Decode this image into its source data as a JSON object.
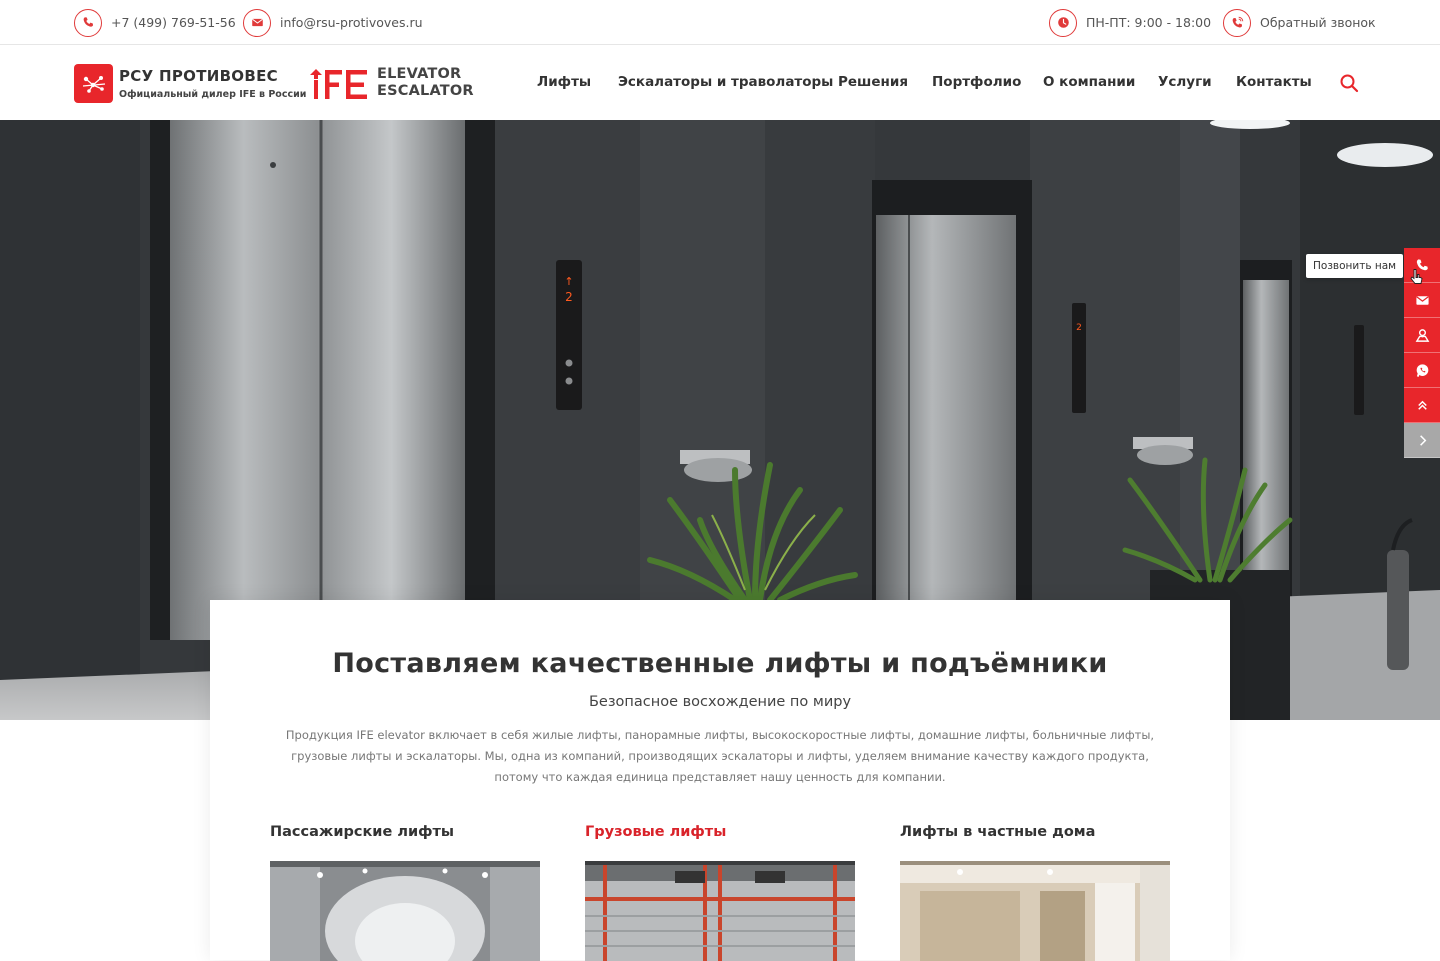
{
  "topbar": {
    "phone": "+7 (499) 769-51-56",
    "email": "info@rsu-protivoves.ru",
    "hours": "ПН-ПТ: 9:00 - 18:00",
    "callback": "Обратный звонок"
  },
  "header": {
    "brand_title": "РСУ ПРОТИВОВЕС",
    "brand_subtitle": "Официальный дилер IFE в России",
    "partner_line1": "ELEVATOR",
    "partner_line2": "ESCALATOR",
    "nav": [
      {
        "label": "Лифты"
      },
      {
        "label": "Эскалаторы и траволаторы"
      },
      {
        "label": "Решения"
      },
      {
        "label": "Портфолио"
      },
      {
        "label": "О компании"
      },
      {
        "label": "Услуги"
      },
      {
        "label": "Контакты"
      }
    ]
  },
  "floor_indicators": [
    "2",
    "2"
  ],
  "side_bar": {
    "tooltip": "Позвонить нам",
    "buttons": [
      "phone-icon",
      "mail-icon",
      "map-icon",
      "whatsapp-icon",
      "scroll-top-icon",
      "collapse-icon"
    ]
  },
  "card": {
    "title": "Поставляем качественные лифты и подъёмники",
    "subtitle": "Безопасное восхождение по миру",
    "description": "Продукция IFE elevator включает в себя жилые лифты, панорамные лифты, высокоскоростные лифты, домашние лифты, больничные лифты, грузовые лифты и эскалаторы. Мы, одна из компаний, производящих эскалаторы и лифты, уделяем внимание качеству каждого продукта, потому что каждая единица представляет нашу ценность для компании.",
    "categories": [
      {
        "label": "Пассажирские лифты",
        "active": false
      },
      {
        "label": "Грузовые лифты",
        "active": true
      },
      {
        "label": "Лифты в частные дома",
        "active": false
      }
    ]
  },
  "colors": {
    "accent": "#e8262b",
    "active_text": "#d9232a",
    "side_gray": "#a8a8a8"
  }
}
